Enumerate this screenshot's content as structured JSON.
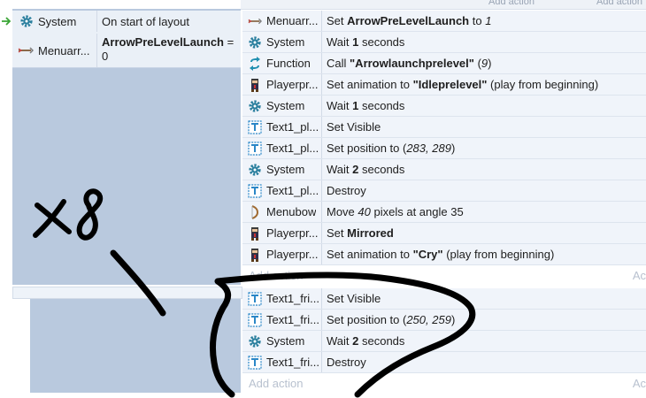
{
  "event_block_1": {
    "condition": {
      "object": "System",
      "text": "On start of layout"
    },
    "sub_condition": {
      "object": "Menuarr...",
      "var": "ArrowPreLevelLaunch",
      "op": " =",
      "value": "0"
    },
    "actions": [
      {
        "object": "Menuarr...",
        "icon": "arrow-icon",
        "pre": "Set ",
        "bold": "ArrowPreLevelLaunch",
        "mid": " to ",
        "italic": "1",
        "post": ""
      },
      {
        "object": "System",
        "icon": "gear-icon",
        "pre": "Wait ",
        "bold": "1",
        "mid": " seconds",
        "italic": "",
        "post": ""
      },
      {
        "object": "Function",
        "icon": "function-icon",
        "pre": "Call ",
        "bold": "\"Arrowlaunchprelevel\"",
        "mid": " (",
        "italic": "9",
        "post": ")"
      },
      {
        "object": "Playerpr...",
        "icon": "player-sprite-icon",
        "pre": "Set animation to ",
        "bold": "\"Idleprelevel\"",
        "mid": " (play from beginning)",
        "italic": "",
        "post": ""
      },
      {
        "object": "System",
        "icon": "gear-icon",
        "pre": "Wait ",
        "bold": "1",
        "mid": " seconds",
        "italic": "",
        "post": ""
      },
      {
        "object": "Text1_pl...",
        "icon": "text-object-icon",
        "pre": "Set Visible",
        "bold": "",
        "mid": "",
        "italic": "",
        "post": ""
      },
      {
        "object": "Text1_pl...",
        "icon": "text-object-icon",
        "pre": "Set position to (",
        "bold": "",
        "mid": "",
        "italic": "283, 289",
        "post": ")"
      },
      {
        "object": "System",
        "icon": "gear-icon",
        "pre": "Wait ",
        "bold": "2",
        "mid": " seconds",
        "italic": "",
        "post": ""
      },
      {
        "object": "Text1_pl...",
        "icon": "text-object-icon",
        "pre": "Destroy",
        "bold": "",
        "mid": "",
        "italic": "",
        "post": ""
      },
      {
        "object": "Menubow",
        "icon": "bow-icon",
        "pre": "Move ",
        "bold": "",
        "mid": "",
        "italic": "40",
        "post": " pixels at angle 35"
      },
      {
        "object": "Playerpr...",
        "icon": "player-sprite-icon",
        "pre": "Set ",
        "bold": "Mirrored",
        "mid": "",
        "italic": "",
        "post": ""
      },
      {
        "object": "Playerpr...",
        "icon": "player-sprite-icon",
        "pre": "Set animation to ",
        "bold": "\"Cry\"",
        "mid": " (play from beginning)",
        "italic": "",
        "post": ""
      }
    ],
    "add_action": "Add action",
    "add_action_short": "Ac"
  },
  "event_block_2": {
    "actions": [
      {
        "object": "Text1_fri...",
        "icon": "text-object-icon",
        "pre": "Set Visible",
        "bold": "",
        "mid": "",
        "italic": "",
        "post": ""
      },
      {
        "object": "Text1_fri...",
        "icon": "text-object-icon",
        "pre": "Set position to (",
        "bold": "",
        "mid": "",
        "italic": "250, 259",
        "post": ")"
      },
      {
        "object": "System",
        "icon": "gear-icon",
        "pre": "Wait ",
        "bold": "2",
        "mid": " seconds",
        "italic": "",
        "post": ""
      },
      {
        "object": "Text1_fri...",
        "icon": "text-object-icon",
        "pre": "Destroy",
        "bold": "",
        "mid": "",
        "italic": "",
        "post": ""
      }
    ],
    "add_action": "Add action",
    "add_action_short": "Ac"
  },
  "top_sliver": {
    "left": "Add action",
    "right": "Add action"
  },
  "annotation": {
    "text": "x8"
  },
  "colors": {
    "accent_green": "#3aa536",
    "gear": "#2a7f9e",
    "function": "#1f8fb0",
    "text_icon": "#2b87c7"
  }
}
